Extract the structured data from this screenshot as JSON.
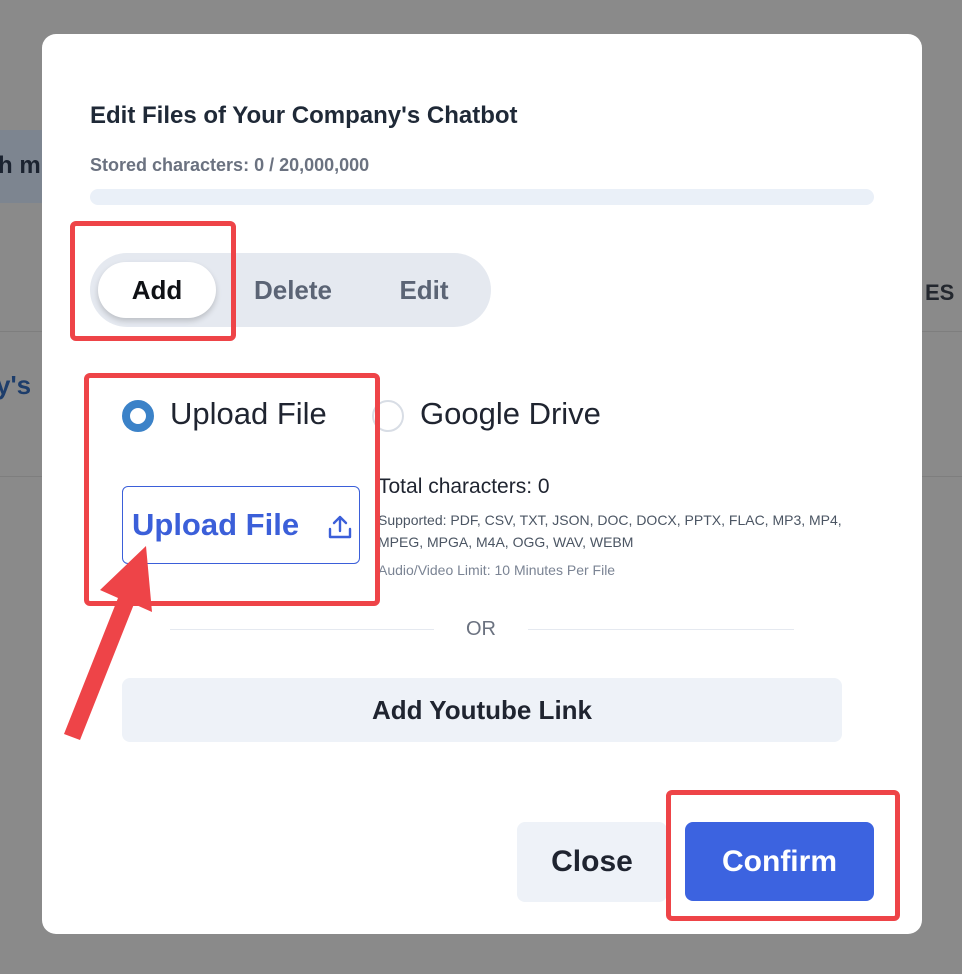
{
  "background": {
    "left_fragment_1": "h m",
    "right_fragment": "ES",
    "left_fragment_2": "y's"
  },
  "modal": {
    "title": "Edit Files of Your Company's Chatbot",
    "stored_characters": "Stored characters: 0 / 20,000,000",
    "storage_progress": 0,
    "tabs": [
      {
        "label": "Add",
        "active": true
      },
      {
        "label": "Delete",
        "active": false
      },
      {
        "label": "Edit",
        "active": false
      }
    ],
    "source_options": [
      {
        "label": "Upload File",
        "selected": true
      },
      {
        "label": "Google Drive",
        "selected": false
      }
    ],
    "upload_button_label": "Upload File",
    "total_characters": "Total characters: 0",
    "supported_formats": "Supported: PDF, CSV, TXT, JSON, DOC, DOCX, PPTX, FLAC, MP3, MP4, MPEG, MPGA, M4A, OGG, WAV, WEBM",
    "media_limit": "Audio/Video Limit: 10 Minutes Per File",
    "divider_text": "OR",
    "youtube_button_label": "Add Youtube Link",
    "close_button_label": "Close",
    "confirm_button_label": "Confirm"
  },
  "colors": {
    "accent": "#3c63e0",
    "highlight": "#ee4448",
    "overlay": "#8a8a8a"
  },
  "icons": {
    "upload": "upload-icon",
    "arrow": "annotation-arrow"
  }
}
